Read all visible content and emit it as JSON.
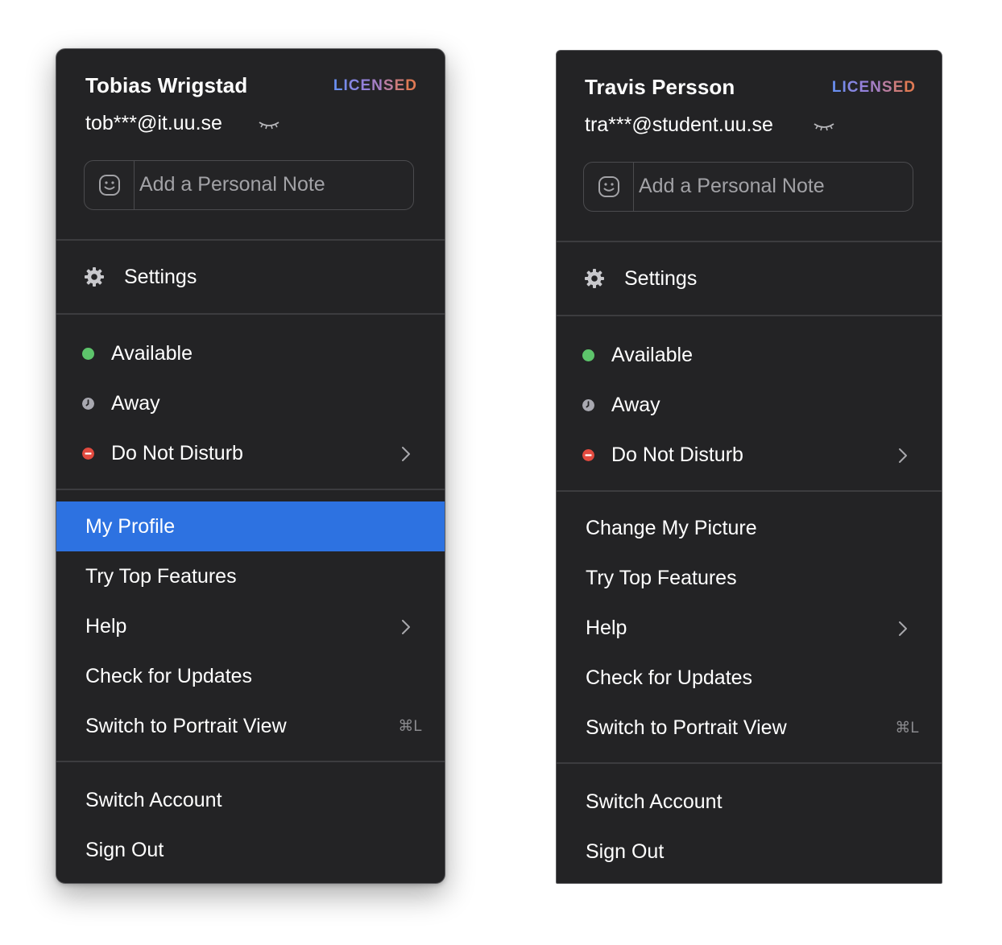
{
  "menus": [
    {
      "user": {
        "name": "Tobias Wrigstad",
        "email": "tob***@it.uu.se",
        "badge": "LICENSED"
      },
      "note": {
        "placeholder": "Add a Personal Note"
      },
      "settings_label": "Settings",
      "statuses": [
        {
          "label": "Available",
          "color": "#5dc46b",
          "icon": "available-dot"
        },
        {
          "label": "Away",
          "color": "#a8a8b0",
          "icon": "away-clock"
        },
        {
          "label": "Do Not Disturb",
          "color": "#e24a3f",
          "icon": "dnd-dot",
          "submenu": true
        }
      ],
      "items": [
        {
          "label": "My Profile",
          "highlighted": true
        },
        {
          "label": "Try Top Features"
        },
        {
          "label": "Help",
          "submenu": true
        },
        {
          "label": "Check for Updates"
        },
        {
          "label": "Switch to Portrait View",
          "shortcut": "⌘L"
        }
      ],
      "account_items": [
        {
          "label": "Switch Account"
        },
        {
          "label": "Sign Out"
        }
      ]
    },
    {
      "user": {
        "name": "Travis Persson",
        "email": "tra***@student.uu.se",
        "badge": "LICENSED"
      },
      "note": {
        "placeholder": "Add a Personal Note"
      },
      "settings_label": "Settings",
      "statuses": [
        {
          "label": "Available",
          "color": "#5dc46b",
          "icon": "available-dot"
        },
        {
          "label": "Away",
          "color": "#a8a8b0",
          "icon": "away-clock"
        },
        {
          "label": "Do Not Disturb",
          "color": "#e24a3f",
          "icon": "dnd-dot",
          "submenu": true
        }
      ],
      "items": [
        {
          "label": "Change My Picture"
        },
        {
          "label": "Try Top Features"
        },
        {
          "label": "Help",
          "submenu": true
        },
        {
          "label": "Check for Updates"
        },
        {
          "label": "Switch to Portrait View",
          "shortcut": "⌘L"
        }
      ],
      "account_items": [
        {
          "label": "Switch Account"
        },
        {
          "label": "Sign Out"
        }
      ]
    }
  ],
  "colors": {
    "menu_bg": "#232325",
    "highlight": "#2d72e1",
    "badge_gradient": [
      "#6a8ff0",
      "#9b7fd6",
      "#e07a55"
    ]
  }
}
